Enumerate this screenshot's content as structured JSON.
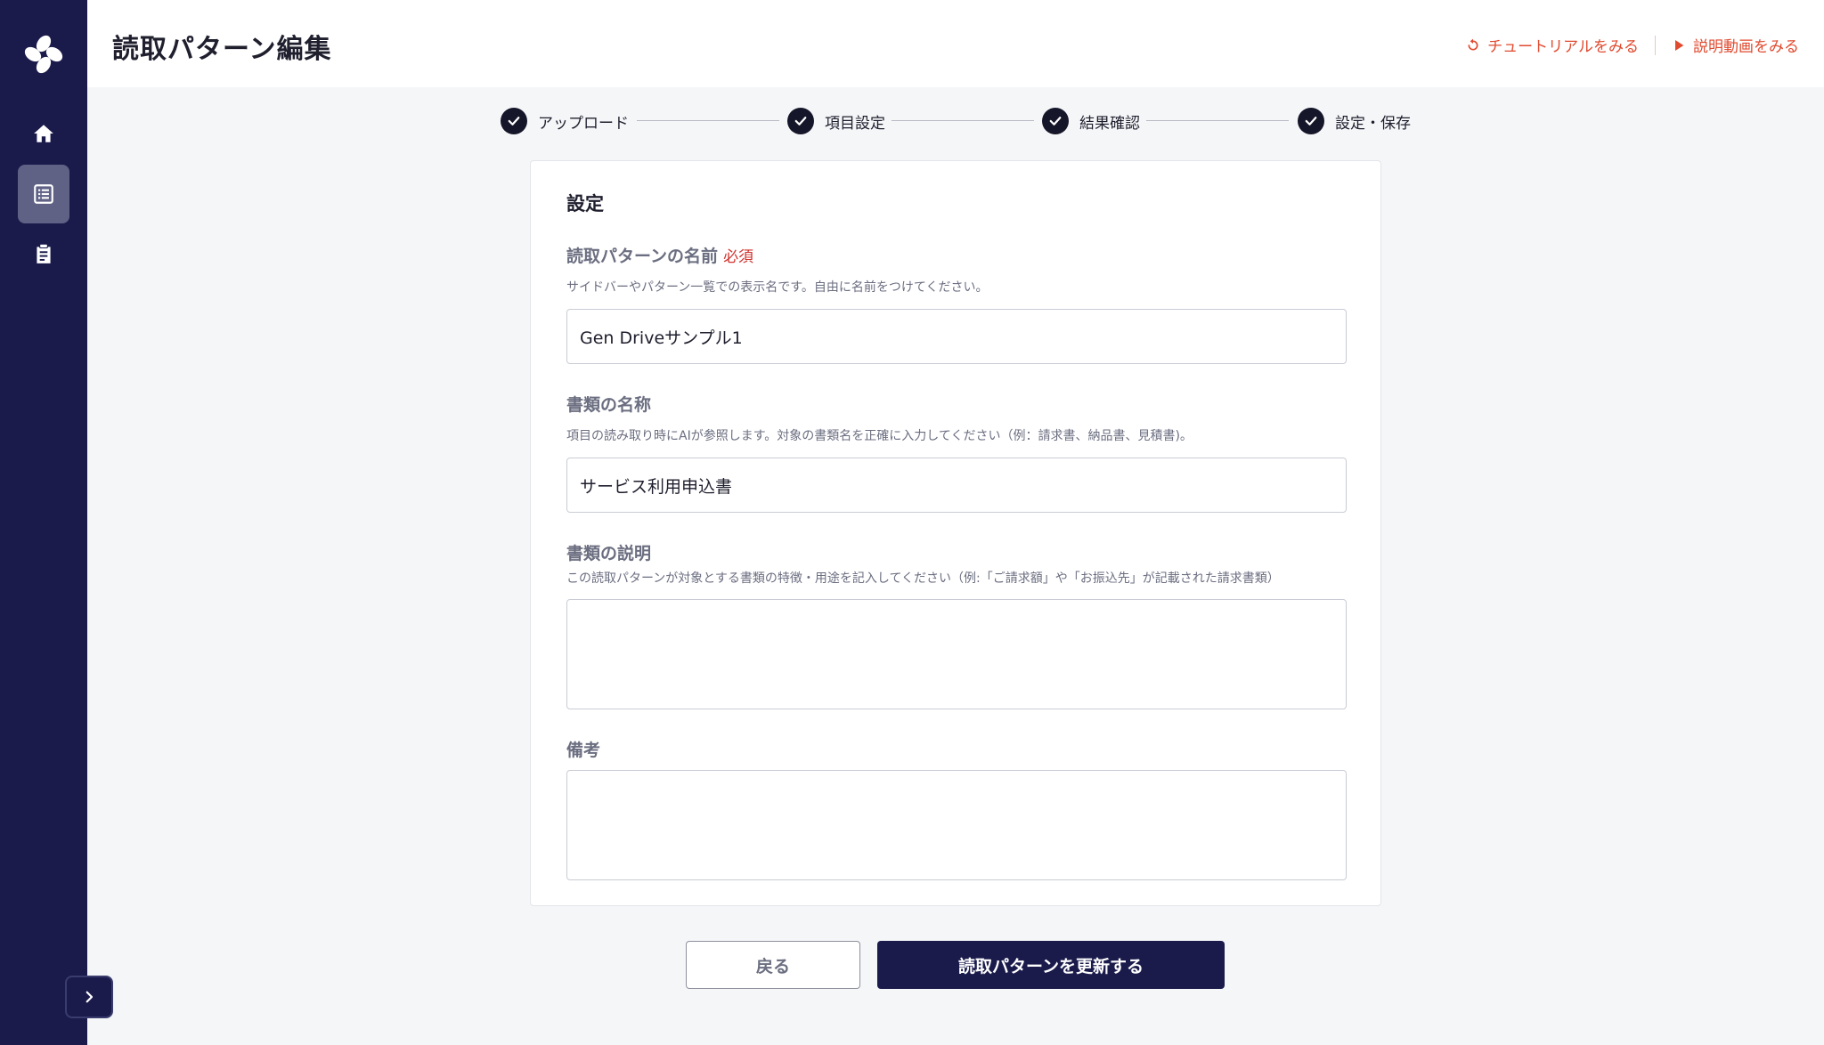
{
  "header": {
    "title": "読取パターン編集",
    "links": {
      "tutorial": "チュートリアルをみる",
      "video": "説明動画をみる"
    }
  },
  "sidebar": {
    "items": [
      {
        "icon": "home-icon",
        "active": false
      },
      {
        "icon": "list-icon",
        "active": true
      },
      {
        "icon": "clipboard-icon",
        "active": false
      }
    ]
  },
  "stepper": {
    "steps": [
      {
        "label": "アップロード",
        "done": true
      },
      {
        "label": "項目設定",
        "done": true
      },
      {
        "label": "結果確認",
        "done": true
      },
      {
        "label": "設定・保存",
        "done": true
      }
    ]
  },
  "form": {
    "section_title": "設定",
    "pattern_name": {
      "label": "読取パターンの名前",
      "required": "必須",
      "help": "サイドバーやパターン一覧での表示名です。自由に名前をつけてください。",
      "value": "Gen Driveサンプル1"
    },
    "document_name": {
      "label": "書類の名称",
      "help": "項目の読み取り時にAIが参照します。対象の書類名を正確に入力してください（例：請求書、納品書、見積書)。",
      "value": "サービス利用申込書"
    },
    "document_description": {
      "label": "書類の説明",
      "help": "この読取パターンが対象とする書類の特徴・用途を記入してください（例:「ご請求額」や「お振込先」が記載された請求書類）",
      "value": ""
    },
    "notes": {
      "label": "備考",
      "value": ""
    }
  },
  "actions": {
    "back": "戻る",
    "update": "読取パターンを更新する"
  },
  "colors": {
    "sidebar": "#1a1b4b",
    "accent_link": "#e04a2f",
    "required": "#d0312d",
    "primary_button": "#1a1b4b"
  }
}
